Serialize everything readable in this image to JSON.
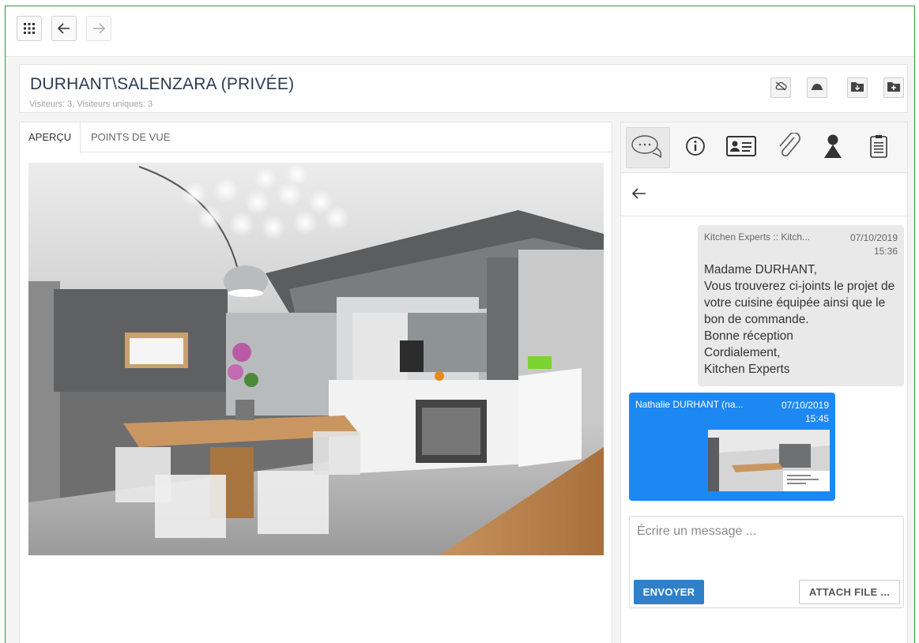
{
  "toolbar": {
    "apps_icon": "grid-icon",
    "back_icon": "arrow-left-icon",
    "forward_icon": "arrow-right-icon"
  },
  "header": {
    "title": "DURHANT\\SALENZARA (PRIVÉE)",
    "subtitle": "Visiteurs: 3, Visiteurs uniques: 3",
    "actions": [
      "cloud-off-icon",
      "hat-icon",
      "download-folder-icon",
      "add-folder-icon"
    ]
  },
  "left_panel": {
    "tabs": [
      {
        "label": "APERÇU",
        "active": true
      },
      {
        "label": "POINTS DE VUE",
        "active": false
      }
    ],
    "preview_alt": "kitchen-render"
  },
  "right_panel": {
    "tabs": [
      "chat-icon",
      "info-icon",
      "contact-card-icon",
      "paperclip-icon",
      "person-icon",
      "notes-icon"
    ],
    "active_tab": "chat-icon",
    "messages": [
      {
        "sender": "Kitchen Experts :: Kitch...",
        "date": "07/10/2019",
        "time": "15:36",
        "body": "Madame DURHANT,\nVous trouverez ci-joints le projet de votre cuisine équipée ainsi que le bon de commande.\nBonne réception\nCordialement,\nKitchen Experts"
      },
      {
        "sender": "Nathalie DURHANT (na...",
        "date": "07/10/2019",
        "time": "15:45",
        "attachment": "image-thumbnail"
      }
    ],
    "composer": {
      "placeholder": "Écrire un message ...",
      "send_label": "ENVOYER",
      "attach_label": "ATTACH FILE ..."
    }
  },
  "colors": {
    "accent_blue": "#2f80c8",
    "bubble_blue": "#1e88f2",
    "frame_green": "#2e9b3c",
    "title_color": "#2a3b52"
  }
}
